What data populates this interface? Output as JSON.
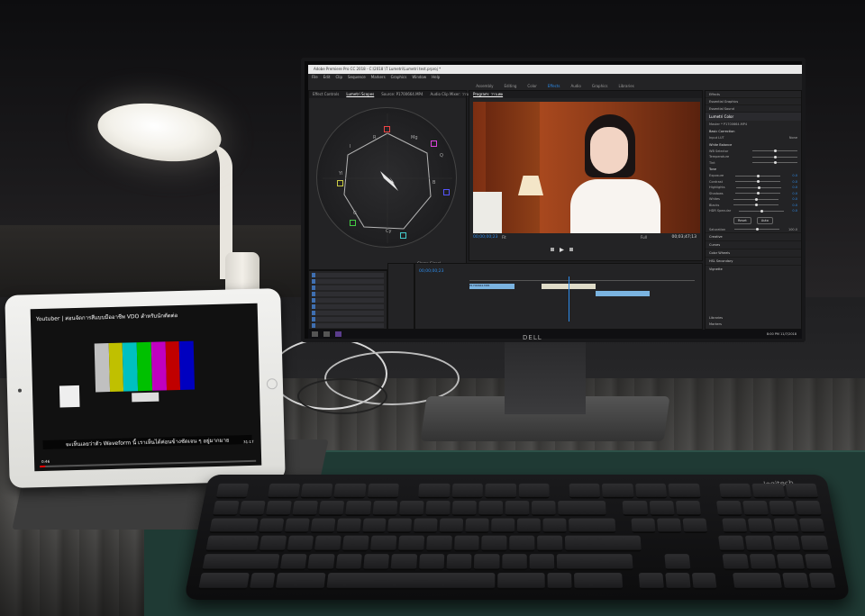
{
  "monitor": {
    "brand": "DELL",
    "app_title": "Adobe Premiere Pro CC 2018 - C:\\2018 \\T Lumetri\\Lumetri test.prproj *",
    "menu": [
      "File",
      "Edit",
      "Clip",
      "Sequence",
      "Markers",
      "Graphics",
      "Window",
      "Help"
    ],
    "workspaces": [
      "Assembly",
      "Editing",
      "Color",
      "Effects",
      "Audio",
      "Graphics",
      "Libraries"
    ],
    "active_workspace": "Effects",
    "scope_panel": {
      "tabs": [
        "Effect Controls",
        "Lumetri Scopes",
        "Source: P1700664.MP4",
        "Audio Clip Mixer: ว่าวเฟค"
      ],
      "selected_tab": "Lumetri Scopes",
      "labels": [
        "R",
        "Mg",
        "B",
        "Cy",
        "G",
        "Yl",
        "Q",
        "I"
      ],
      "footer": "Clamp Signal"
    },
    "program": {
      "title": "Program: ว่าวเฟค",
      "timecode_in": "00;00;00;23",
      "timecode_out": "00;03;47;13",
      "fit": "Fit",
      "res": "Full"
    },
    "lumetri": {
      "effects_items": [
        "Effects",
        "Essential Graphics",
        "Essential Sound"
      ],
      "header": "Lumetri Color",
      "master": "Master * P1700664.MP4",
      "sections": [
        "Basic Correction",
        "White Balance",
        "Tone"
      ],
      "input_lut_label": "Input LUT",
      "input_lut_value": "None",
      "wb_rows": [
        "WB Selector",
        "Temperature",
        "Tint"
      ],
      "tone_rows": [
        "Exposure",
        "Contrast",
        "Highlights",
        "Shadows",
        "Whites",
        "Blacks",
        "HDR Specular"
      ],
      "values": [
        "0.0",
        "0.0",
        "0.0",
        "0.0",
        "0.0",
        "0.0",
        "0.0"
      ],
      "buttons": [
        "Reset",
        "Auto"
      ],
      "saturation_label": "Saturation",
      "saturation_value": "100.0",
      "collapsed": [
        "Creative",
        "Curves",
        "Color Wheels",
        "HSL Secondary",
        "Vignette"
      ],
      "bottom": [
        "Libraries",
        "Markers"
      ]
    },
    "timeline": {
      "timecode": "00;00;00;23",
      "clip_label": "P1700664.MP4"
    },
    "taskbar": {
      "clock": "8:00 PM",
      "date": "11/7/2018"
    }
  },
  "tablet": {
    "video_title": "Youtuber | สอนจัดการสีแบบมืออาชีพ VDO สำหรับนักตัดต่อ",
    "caption": "จะเห็นเลยว่าตัว Waveform นี้ เราเห็นได้ค่อนข้างชัดเจน ๆ อยู่มากมาย",
    "current_time": "0:46",
    "duration": "31:17",
    "progress_fraction": 0.025,
    "colorbar_colors": [
      "#c0c0c0",
      "#c0c000",
      "#00c0c0",
      "#00c000",
      "#c000c0",
      "#c00000",
      "#0000c0"
    ]
  },
  "keyboard": {
    "brand": "logitech"
  }
}
